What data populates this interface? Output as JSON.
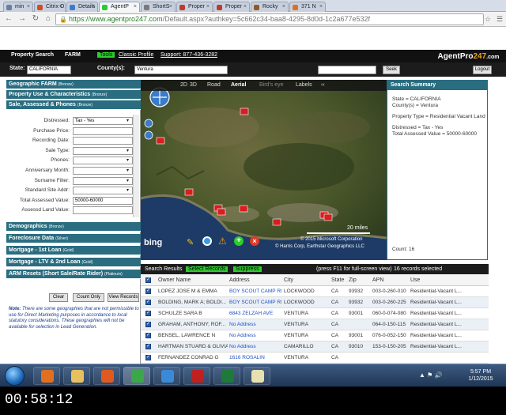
{
  "browser": {
    "tabs": [
      {
        "label": "min",
        "color": "#6a7f9e"
      },
      {
        "label": "Citrix O",
        "color": "#d44a2a"
      },
      {
        "label": "Details",
        "color": "#3c7bd0"
      },
      {
        "label": "AgentP",
        "color": "#2ecc2e"
      },
      {
        "label": "ShortS",
        "color": "#7a7a7a"
      },
      {
        "label": "Proper",
        "color": "#c0392b"
      },
      {
        "label": "Proper",
        "color": "#c0392b"
      },
      {
        "label": "Rocky",
        "color": "#8e5a2a"
      },
      {
        "label": "371 N",
        "color": "#e07020"
      }
    ],
    "url_host": "https://www.agentpro247.com",
    "url_path": "/Default.aspx?authkey=5c662c34-baa8-4295-8d0d-1c2a677e532f"
  },
  "app": {
    "menu": {
      "property_search": "Property Search",
      "farm": "FARM",
      "tools": "Tools",
      "classic_profile": "Classic Profile",
      "support": "Support: 877-436-3282"
    },
    "logo": {
      "prefix": "AgentPro",
      "num": "247",
      "suffix": ".com"
    },
    "state_label": "State:",
    "state_value": "CALIFORNIA",
    "county_label": "County(s):",
    "county_value": "Ventura",
    "seek": "Seek",
    "logout": "Logout"
  },
  "left": {
    "sections_top": [
      {
        "label": "Geographic FARM",
        "tag": "(Bronze)"
      },
      {
        "label": "Property Use & Characteristics",
        "tag": "(Bronze)"
      },
      {
        "label": "Sale, Assessed & Phones",
        "tag": "(Bronze)"
      }
    ],
    "fields": [
      {
        "label": "Distressed:",
        "value": "Tax - Yes",
        "dropdown": true
      },
      {
        "label": "Purchase Price:",
        "value": ""
      },
      {
        "label": "Recording Date:",
        "value": ""
      },
      {
        "label": "Sale Type:",
        "value": "",
        "dropdown": true
      },
      {
        "label": "Phones:",
        "value": "",
        "dropdown": true
      },
      {
        "label": "Anniversary Month:",
        "value": "",
        "dropdown": true
      },
      {
        "label": "Surname Filter:",
        "value": "",
        "dropdown": true
      },
      {
        "label": "Standard Site Addr:",
        "value": "",
        "dropdown": true
      },
      {
        "label": "Total Assessed Value:",
        "value": "50000-60000"
      },
      {
        "label": "Assessd Land Value:",
        "value": ""
      }
    ],
    "sections_bottom": [
      {
        "label": "Demographics",
        "tag": "(Bronze)"
      },
      {
        "label": "Foreclosure Data",
        "tag": "(Silver)"
      },
      {
        "label": "Mortgage - 1st Loan",
        "tag": "(Gold)"
      },
      {
        "label": "Mortgage - LTV & 2nd Loan",
        "tag": "(Gold)"
      },
      {
        "label": "ARM Resets (Short Sale/Rate Rider)",
        "tag": "(Platinum)"
      }
    ],
    "buttons": {
      "clear": "Clear",
      "count_only": "Count Only",
      "view_records": "View Records"
    },
    "note_bold": "Note:",
    "note_text": "There are some geographies that are not permissible to use for Direct Marketing purposes in accordance to local statutory considerations. These geographies will not be available for selection in Lead Generation."
  },
  "map": {
    "tools": {
      "mode2d": "2D",
      "mode3d": "3D",
      "road": "Road",
      "aerial": "Aerial",
      "birdseye": "Bird's eye",
      "labels": "Labels"
    },
    "scale": "20 miles",
    "copyright1": "© 2015 Microsoft Corporation",
    "copyright2": "© Harris Corp, Earthstar Geographics LLC",
    "brand": "bing"
  },
  "summary": {
    "title": "Search Summary",
    "state_line": "State = CALIFORNIA",
    "county_line": "County(s) = Ventura",
    "ptype_line": "Property Type = Residential Vacant Land",
    "distressed_line": "Distressed = Tax - Yes",
    "tav_line": "Total Assessed Value = 50000-60000",
    "count_line": "Count: 16"
  },
  "results": {
    "label": "Search Results",
    "select_records": "Select Records",
    "suppress": "Suppress",
    "hint": "(press F11 for full-screen view)",
    "selected": "16 records selected",
    "columns": [
      "Owner Name",
      "Address",
      "City",
      "State",
      "Zip",
      "APN",
      "Use"
    ],
    "rows": [
      {
        "owner": "LOPEZ JOSE M & EMMA",
        "address": "BOY SCOUT CAMP RD",
        "city": "LOCKWOOD",
        "state": "CA",
        "zip": "93932",
        "apn": "003-0-260-010",
        "use": "Residential-Vacant L..."
      },
      {
        "owner": "BOLDING, MARK A; BOLDI...",
        "address": "BOY SCOUT CAMP RD",
        "city": "LOCKWOOD",
        "state": "CA",
        "zip": "93932",
        "apn": "003-0-260-225",
        "use": "Residential-Vacant L..."
      },
      {
        "owner": "SCHULZE SARA B",
        "address": "6843 ZELZAH AVE",
        "city": "VENTURA",
        "state": "CA",
        "zip": "93001",
        "apn": "060-0-074-080",
        "use": "Residential-Vacant L..."
      },
      {
        "owner": "GRAHAM, ANTHONY; ROF...",
        "address": "No Address",
        "city": "VENTURA",
        "state": "CA",
        "zip": "",
        "apn": "064-0-150-115",
        "use": "Residential-Vacant L..."
      },
      {
        "owner": "BENSEL, LAWRENCE N",
        "address": "No Address",
        "city": "VENTURA",
        "state": "CA",
        "zip": "93001",
        "apn": "076-0-052-150",
        "use": "Residential-Vacant L..."
      },
      {
        "owner": "HARTMAN STUARD & OLIVIA",
        "address": "No Address",
        "city": "CAMARILLO",
        "state": "CA",
        "zip": "93010",
        "apn": "153-0-150-205",
        "use": "Residential-Vacant L..."
      },
      {
        "owner": "FERNANDEZ CONRAD G",
        "address": "1616 ROSALIN",
        "city": "VENTURA",
        "state": "CA",
        "zip": "",
        "apn": "",
        "use": ""
      }
    ]
  },
  "taskbar": {
    "time": "5:57 PM",
    "date": "1/12/2015",
    "icons": [
      "media-player",
      "folder",
      "firefox",
      "chrome",
      "ie",
      "filezilla",
      "excel",
      "mail"
    ]
  },
  "video_timer": "00:58:12"
}
